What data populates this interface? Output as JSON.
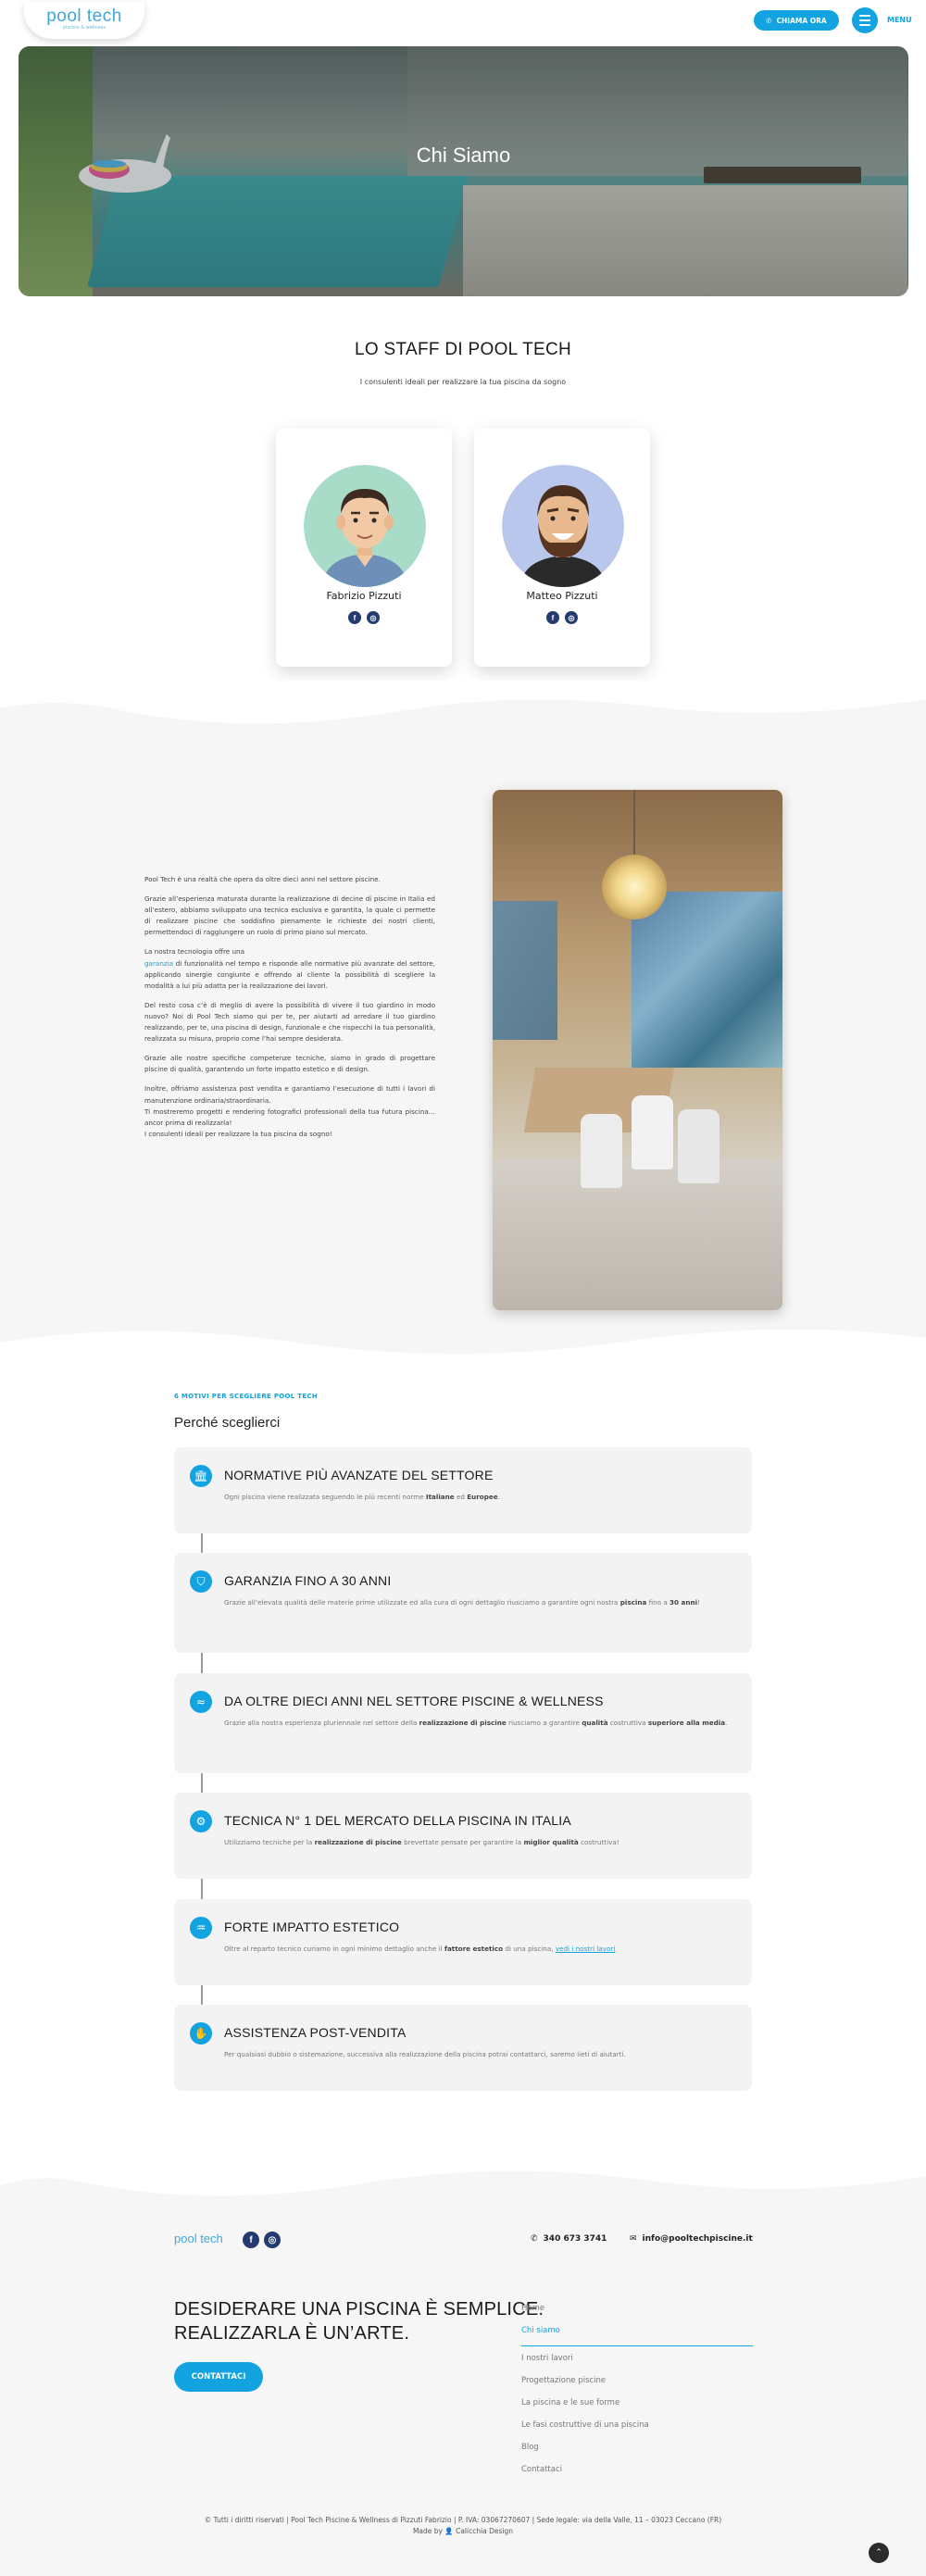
{
  "header": {
    "logo_text": "pool tech",
    "logo_sub": "piscine & wellness",
    "call_label": "CHIAMA ORA",
    "menu_label": "MENU"
  },
  "hero": {
    "title": "Chi Siamo"
  },
  "staff": {
    "title": "LO STAFF DI POOL TECH",
    "subtitle": "I consulenti ideali per realizzare la tua piscina da sogno",
    "members": [
      {
        "name": "Fabrizio Pizzuti",
        "facebook": "f",
        "instagram": "◎"
      },
      {
        "name": "Matteo Pizzuti",
        "facebook": "f",
        "instagram": "◎"
      }
    ]
  },
  "about": {
    "p1": "Pool Tech è una realtà che opera da oltre dieci anni nel settore piscine.",
    "p2": "Grazie all’esperienza maturata durante la realizzazione di decine di piscine in Italia ed all’estero, abbiamo sviluppato una tecnica esclusiva e garantita, la quale ci permette di realizzare piscine che soddisfino pienamente le richieste dei nostri clienti, permettendoci di raggiungere un ruolo di primo piano sul mercato.",
    "p3a": "La nostra tecnologia offre una",
    "p3_link": "garanzia",
    "p3b": "di funzionalità nel tempo e risponde alle normative più avanzate del settore, applicando sinergie congiunte e offrendo al cliente la possibilità di scegliere la modalità a lui più adatta per la realizzazione dei lavori.",
    "p4": "Del resto cosa c’è di meglio di avere la possibilità di vivere il tuo giardino in modo nuovo? Noi di Pool Tech siamo qui per te, per aiutarti ad arredare il tuo giardino realizzando, per te, una piscina di design, funzionale e che rispecchi la tua personalità, realizzata su misura, proprio come l’hai sempre desiderata.",
    "p5": "Grazie alle nostre specifiche competenze tecniche, siamo in grado di progettare piscine di qualità, garantendo un forte impatto estetico e di design.",
    "p6a": "Inoltre, offriamo assistenza post vendita e garantiamo l’esecuzione di tutti i lavori di manutenzione ordinaria/straordinaria.",
    "p6b": "Ti mostreremo progetti e rendering fotografici professionali della tua futura piscina… ancor prima di realizzarla!",
    "p6c": " I consulenti ideali per realizzare la tua piscina da sogno!"
  },
  "why": {
    "kicker": "6 MOTIVI PER SCEGLIERE POOL TECH",
    "title": "Perché sceglierci",
    "features": [
      {
        "icon": "bank-icon",
        "glyph": "🏛",
        "title": "NORMATIVE PIÙ AVANZATE DEL SETTORE",
        "d1": "Ogni piscina viene realizzata seguendo le più recenti norme ",
        "b1": "Italiane",
        "d2": " ed ",
        "b2": "Europee",
        "d3": "."
      },
      {
        "icon": "shield-icon",
        "glyph": "⛉",
        "title": "GARANZIA FINO A 30 ANNI",
        "d1": "Grazie all’elevata qualità delle materie prime utilizzate ed alla cura di ogni dettaglio riusciamo a garantire ogni nostra ",
        "b1": "piscina",
        "d2": " fino a ",
        "b2": "30 anni",
        "d3": "!"
      },
      {
        "icon": "swimmer-icon",
        "glyph": "≈",
        "title": "DA OLTRE DIECI ANNI NEL SETTORE PISCINE & WELLNESS",
        "d1": "Grazie alla nostra esperienza pluriennale nel settore della ",
        "b1": "realizzazione di piscine",
        "d2": " riusciamo a garantire ",
        "b2": "qualità",
        "d3": " costruttiva ",
        "b3": "superiore alla media",
        "d4": "."
      },
      {
        "icon": "network-icon",
        "glyph": "⚙",
        "title": "TECNICA N° 1 DEL MERCATO DELLA PISCINA IN ITALIA",
        "d1": "Utilizziamo tecniche per la ",
        "b1": "realizzazione di piscine",
        "d2": " brevettate pensate per garantire la ",
        "b2": "miglior qualità",
        "d3": " costruttiva!"
      },
      {
        "icon": "pool-ladder-icon",
        "glyph": "♒",
        "title": "FORTE IMPATTO ESTETICO",
        "d1": "Oltre al reparto tecnico curiamo in ogni minimo dettaglio anche il ",
        "b1": "fattore estetico",
        "d2": " di una piscina, ",
        "link": "vedi i nostri lavori"
      },
      {
        "icon": "handshake-icon",
        "glyph": "✋",
        "title": "ASSISTENZA POST-VENDITA",
        "d1": "Per qualsiasi dubbio o sistemazione, successiva alla realizzazione della piscina potrai contattarci, saremo lieti di aiutarti."
      }
    ]
  },
  "footer": {
    "logo_text": "pool tech",
    "phone": "340 673 3741",
    "email": "info@pooltechpiscine.it",
    "headline_1": "DESIDERARE UNA PISCINA È SEMPLICE.",
    "headline_2": "REALIZZARLA È UN’ARTE.",
    "cta": "CONTATTACI",
    "nav": [
      "Home",
      "Chi siamo",
      "I nostri lavori",
      "Progettazione piscine",
      "La piscina e le sue forme",
      "Le fasi costruttive di una piscina",
      "Blog",
      "Contattaci"
    ],
    "nav_active_index": 1,
    "copyright": "© Tutti i diritti riservati | Pool Tech Piscine & Wellness di Pizzuti Fabrizio | P. IVA: 03067270607 | Sede legale: via della Valle, 11 – 03023 Ceccano (FR)",
    "made_by_label": "Made by",
    "made_by_name": "Calicchia Design",
    "to_top": "⌃"
  },
  "colors": {
    "accent": "#12a3e0",
    "dark_social": "#233b6e",
    "band": "#f6f6f6"
  }
}
